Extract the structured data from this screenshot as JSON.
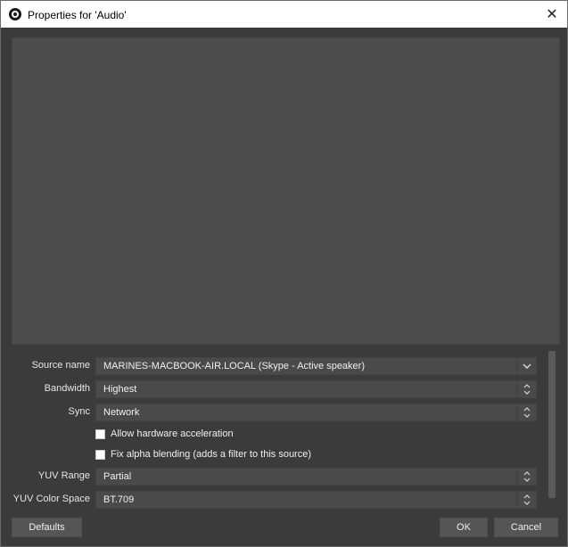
{
  "window": {
    "title": "Properties for 'Audio'",
    "close_glyph": "✕"
  },
  "properties": {
    "source_name": {
      "label": "Source name",
      "value": "MARINES-MACBOOK-AIR.LOCAL (Skype - Active speaker)"
    },
    "bandwidth": {
      "label": "Bandwidth",
      "value": "Highest"
    },
    "sync": {
      "label": "Sync",
      "value": "Network"
    },
    "hw_accel": {
      "label": "Allow hardware acceleration",
      "checked": false
    },
    "fix_alpha": {
      "label": "Fix alpha blending (adds a filter to this source)",
      "checked": false
    },
    "yuv_range": {
      "label": "YUV Range",
      "value": "Partial"
    },
    "yuv_color_space": {
      "label": "YUV Color Space",
      "value": "BT.709"
    }
  },
  "buttons": {
    "defaults": "Defaults",
    "ok": "OK",
    "cancel": "Cancel"
  },
  "glyphs": {
    "chevron_down": "⌄",
    "spin_up": "▲",
    "spin_down": "▼"
  }
}
